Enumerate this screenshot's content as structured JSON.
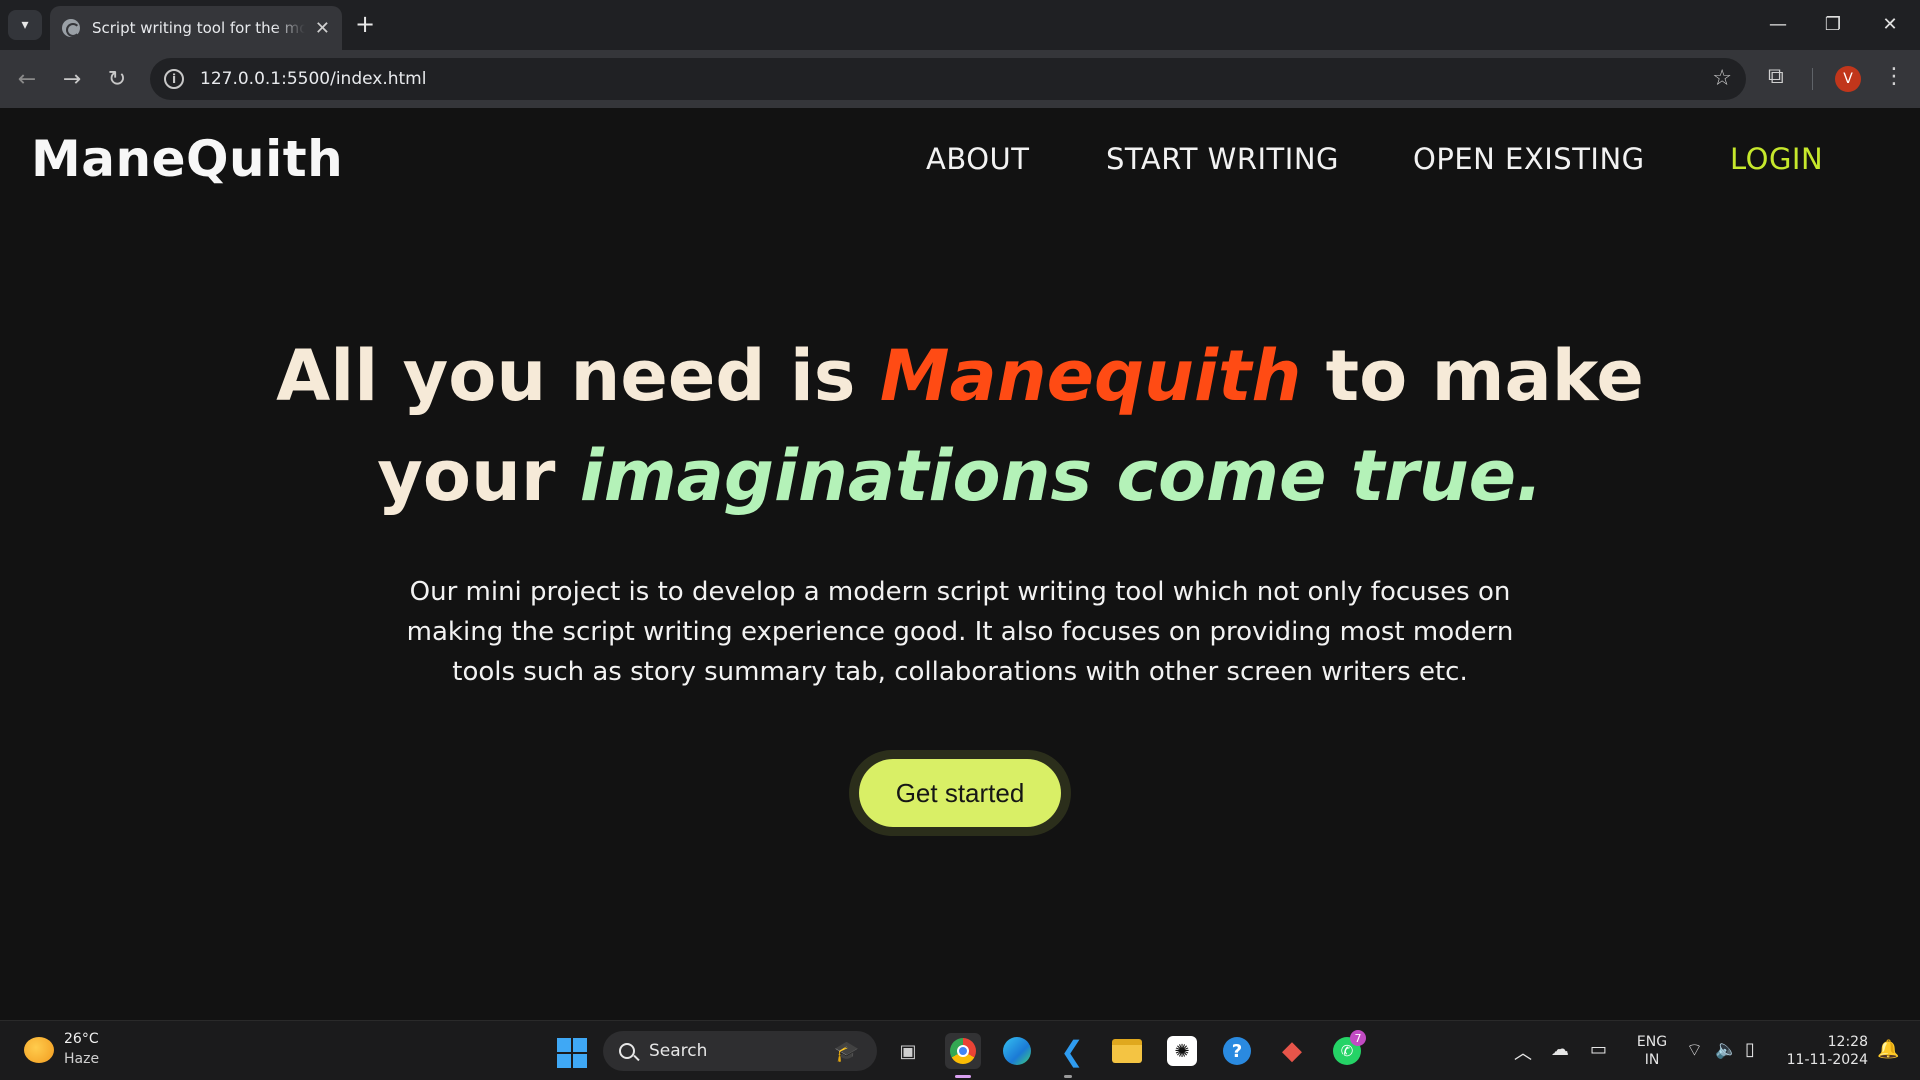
{
  "browser": {
    "tab_title": "Script writing tool for the mode",
    "url": "127.0.0.1:5500/index.html",
    "profile_initial": "V"
  },
  "site": {
    "logo": "ManeQuith",
    "nav": {
      "about": "ABOUT",
      "start_writing": "START WRITING",
      "open_existing": "OPEN EXISTING",
      "login": "LOGIN"
    },
    "hero": {
      "part1": "All you need is ",
      "brand": "Manequith",
      "part2": " to make",
      "part3": "your ",
      "highlight": "imaginations come true."
    },
    "description": "Our mini project is to develop a modern script writing tool which not only focuses on making the script writing experience good. It also focuses on providing most modern tools such as story summary tab, collaborations with other screen writers etc.",
    "cta": "Get started"
  },
  "taskbar": {
    "weather_temp": "26°C",
    "weather_desc": "Haze",
    "search_placeholder": "Search",
    "whatsapp_badge": "7",
    "lang_top": "ENG",
    "lang_bottom": "IN",
    "time": "12:28",
    "date": "11-11-2024"
  },
  "colors": {
    "brand_orange": "#ff4b14",
    "highlight_green": "#b4f2b8",
    "login_lime": "#c6e82c",
    "cta_bg": "#d9ef66"
  }
}
